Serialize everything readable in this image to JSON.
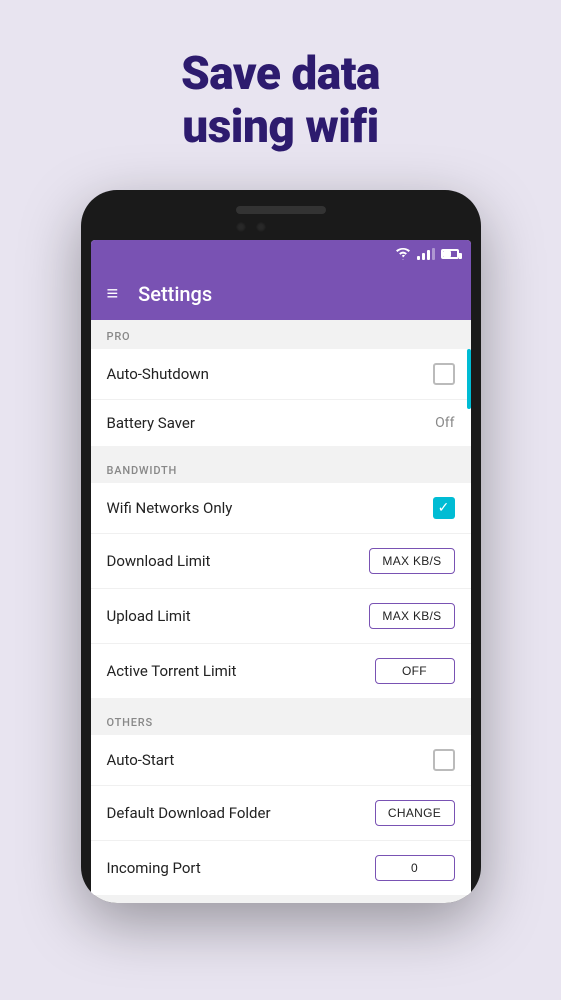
{
  "hero": {
    "line1": "Save data",
    "line2": "using wifi"
  },
  "statusBar": {
    "icons": [
      "wifi",
      "signal",
      "battery"
    ]
  },
  "appBar": {
    "title": "Settings",
    "menuIcon": "≡"
  },
  "sections": [
    {
      "id": "pro",
      "header": "PRO",
      "items": [
        {
          "label": "Auto-Shutdown",
          "controlType": "checkbox",
          "checked": false
        },
        {
          "label": "Battery Saver",
          "controlType": "value",
          "value": "Off"
        }
      ]
    },
    {
      "id": "bandwidth",
      "header": "BANDWIDTH",
      "items": [
        {
          "label": "Wifi Networks Only",
          "controlType": "checkbox-checked",
          "checked": true
        },
        {
          "label": "Download Limit",
          "controlType": "button",
          "buttonLabel": "MAX KB/S"
        },
        {
          "label": "Upload Limit",
          "controlType": "button",
          "buttonLabel": "MAX KB/S"
        },
        {
          "label": "Active Torrent Limit",
          "controlType": "button",
          "buttonLabel": "OFF"
        }
      ]
    },
    {
      "id": "others",
      "header": "OTHERS",
      "items": [
        {
          "label": "Auto-Start",
          "controlType": "checkbox",
          "checked": false
        },
        {
          "label": "Default Download Folder",
          "controlType": "button",
          "buttonLabel": "CHANGE"
        },
        {
          "label": "Incoming Port",
          "controlType": "button",
          "buttonLabel": "0"
        }
      ]
    }
  ]
}
